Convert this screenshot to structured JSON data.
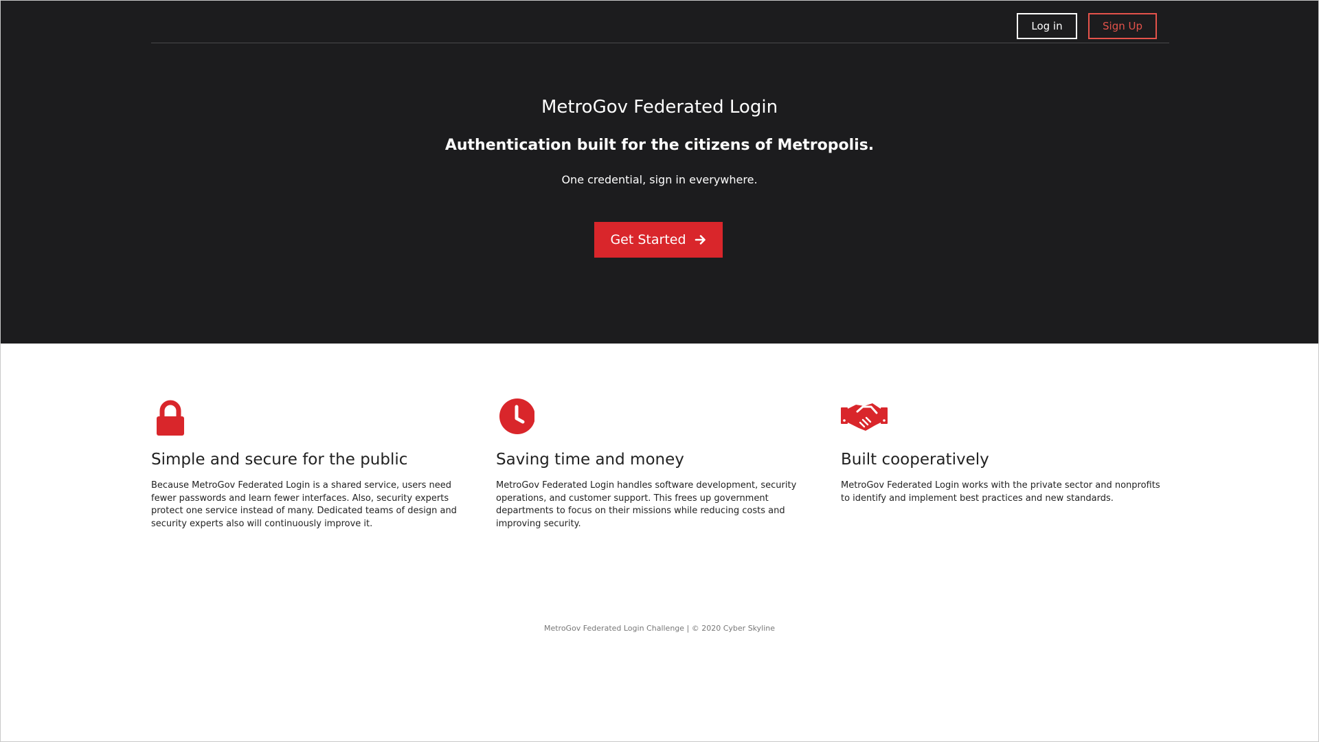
{
  "nav": {
    "login_label": "Log in",
    "signup_label": "Sign Up"
  },
  "hero": {
    "title": "MetroGov Federated Login",
    "subtitle": "Authentication built for the citizens of Metropolis.",
    "tagline": "One credential, sign in everywhere.",
    "cta_label": "Get Started",
    "cta_icon": "arrow-right-icon"
  },
  "features": [
    {
      "icon": "lock-icon",
      "title": "Simple and secure for the public",
      "text": "Because MetroGov Federated Login is a shared service, users need fewer passwords and learn fewer interfaces. Also, security experts protect one service instead of many. Dedicated teams of design and security experts also will continuously improve it."
    },
    {
      "icon": "clock-icon",
      "title": "Saving time and money",
      "text": "MetroGov Federated Login handles software development, security operations, and customer support. This frees up government departments to focus on their missions while reducing costs and improving security."
    },
    {
      "icon": "handshake-icon",
      "title": "Built cooperatively",
      "text": "MetroGov Federated Login works with the private sector and nonprofits to identify and implement best practices and new standards."
    }
  ],
  "footer": {
    "text": "MetroGov Federated Login Challenge | © 2020 Cyber Skyline"
  },
  "colors": {
    "hero_background": "#1c1c1e",
    "accent_red": "#d9262b",
    "signup_border": "#e5534b"
  }
}
